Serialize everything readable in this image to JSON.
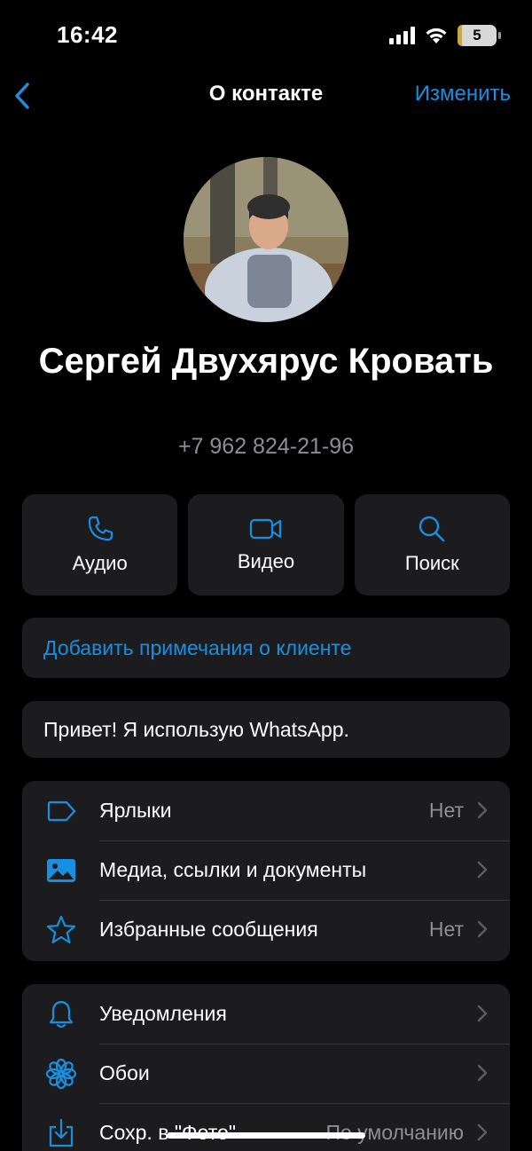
{
  "status": {
    "time": "16:42",
    "battery": "5",
    "battery_level_percent": 5
  },
  "nav": {
    "back_icon": "chevron-left-icon",
    "title": "О контакте",
    "edit": "Изменить"
  },
  "contact": {
    "name": "Сергей Двухярус Кровать",
    "phone": "+7 962 824-21-96"
  },
  "actions": [
    {
      "label": "Аудио",
      "icon": "phone-icon"
    },
    {
      "label": "Видео",
      "icon": "video-camera-icon"
    },
    {
      "label": "Поиск",
      "icon": "search-icon"
    }
  ],
  "notes_link": "Добавить примечания о клиенте",
  "about": "Привет! Я использую WhatsApp.",
  "list1": [
    {
      "label": "Ярлыки",
      "value": "Нет",
      "icon": "tag-icon"
    },
    {
      "label": "Медиа, ссылки и документы",
      "value": "",
      "icon": "image-icon"
    },
    {
      "label": "Избранные сообщения",
      "value": "Нет",
      "icon": "star-icon"
    }
  ],
  "list2": [
    {
      "label": "Уведомления",
      "value": "",
      "icon": "bell-icon"
    },
    {
      "label": "Обои",
      "value": "",
      "icon": "flower-icon"
    },
    {
      "label": "Сохр. в \"Фото\"",
      "value": "По умолчанию",
      "icon": "download-icon"
    }
  ],
  "colors": {
    "accent": "#1a8fe0",
    "background": "#000000",
    "card": "#1c1c1e",
    "secondary_text": "#8e8e93"
  }
}
